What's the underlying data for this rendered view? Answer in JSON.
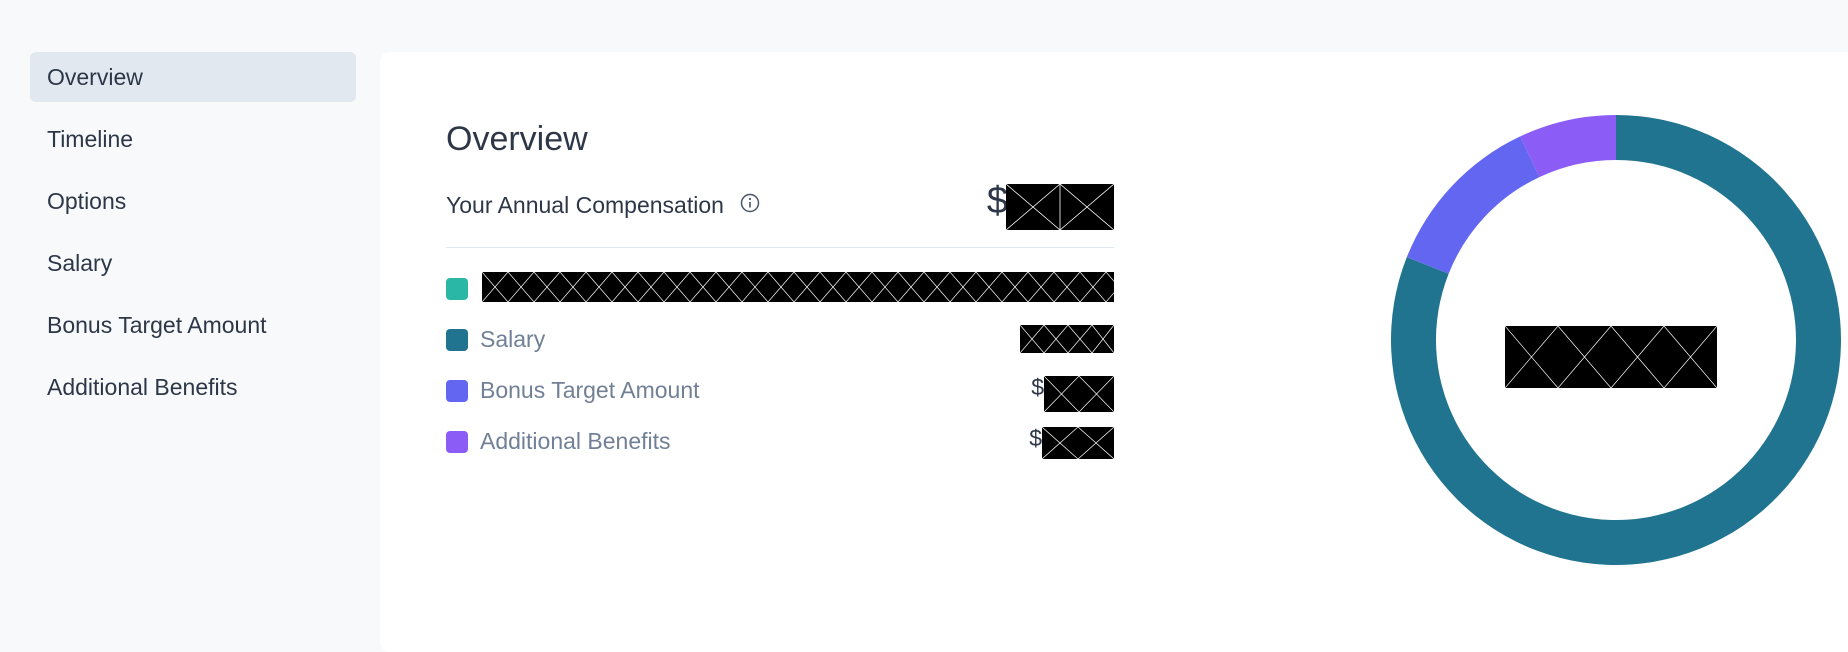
{
  "sidebar": {
    "items": [
      {
        "label": "Overview",
        "active": true
      },
      {
        "label": "Timeline",
        "active": false
      },
      {
        "label": "Options",
        "active": false
      },
      {
        "label": "Salary",
        "active": false
      },
      {
        "label": "Bonus Target Amount",
        "active": false
      },
      {
        "label": "Additional Benefits",
        "active": false
      }
    ]
  },
  "main": {
    "title": "Overview",
    "compensation_label": "Your Annual Compensation",
    "compensation_currency": "$",
    "legend": [
      {
        "label": "",
        "color": "#2bb7a6",
        "currency": ""
      },
      {
        "label": "Salary",
        "color": "#21748f",
        "currency": ""
      },
      {
        "label": "Bonus Target Amount",
        "color": "#6366f1",
        "currency": "$"
      },
      {
        "label": "Additional Benefits",
        "color": "#8b5cf6",
        "currency": "$"
      }
    ]
  },
  "chart_data": {
    "type": "pie",
    "donut": true,
    "categories": [
      "Salary",
      "Bonus Target Amount",
      "Additional Benefits"
    ],
    "values": [
      81,
      12,
      7
    ],
    "colors": [
      "#21748f",
      "#6366f1",
      "#8b5cf6"
    ]
  }
}
